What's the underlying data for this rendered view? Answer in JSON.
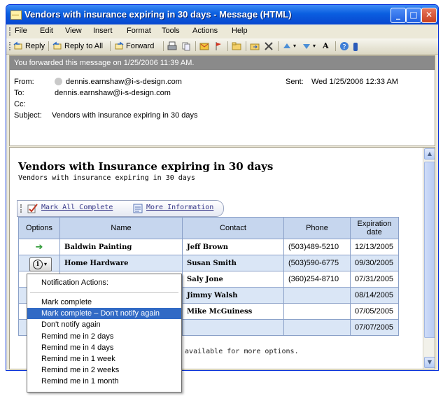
{
  "window": {
    "title": "Vendors with insurance expiring in 30 days - Message (HTML)",
    "min": "_",
    "max": "□",
    "close": "✕"
  },
  "menu": [
    "File",
    "Edit",
    "View",
    "Insert",
    "Format",
    "Tools",
    "Actions",
    "Help"
  ],
  "toolbar": {
    "reply": "Reply",
    "reply_all": "Reply to All",
    "forward": "Forward",
    "format": "A"
  },
  "header": {
    "info": "You forwarded this message on 1/25/2006 11:39 AM.",
    "from_label": "From:",
    "from_value": "dennis.earnshaw@i-s-design.com",
    "to_label": "To:",
    "to_value": "dennis.earnshaw@i-s-design.com",
    "cc_label": "Cc:",
    "subject_label": "Subject:",
    "subject_value": "Vendors with insurance expiring in 30 days",
    "sent_label": "Sent:",
    "sent_value": "Wed 1/25/2006 12:33 AM"
  },
  "doc": {
    "title": "Vendors with Insurance expiring in 30 days",
    "subtitle": "Vendors with insurance expiring in 30 days",
    "mark_all": "Mark All Complete",
    "more_info": "More Information",
    "footer_note": "n available for more options."
  },
  "table": {
    "headers": [
      "Options",
      "Name",
      "Contact",
      "Phone",
      "Expiration date"
    ],
    "rows": [
      {
        "name": "Baldwin Painting",
        "contact": "Jeff Brown",
        "phone": "(503)489-5210",
        "date": "12/13/2005"
      },
      {
        "name": "Home Hardware",
        "contact": "Susan Smith",
        "phone": "(503)590-6775",
        "date": "09/30/2005"
      },
      {
        "name": "",
        "contact": "Saly Jone",
        "phone": "(360)254-8710",
        "date": "07/31/2005"
      },
      {
        "name": "",
        "contact": "Jimmy Walsh",
        "phone": "",
        "date": "08/14/2005"
      },
      {
        "name": "",
        "contact": "Mike McGuiness",
        "phone": "",
        "date": "07/05/2005"
      },
      {
        "name": "",
        "contact": "",
        "phone": "",
        "date": "07/07/2005"
      }
    ]
  },
  "context_menu": {
    "header": "Notification Actions:",
    "items": [
      "Mark complete",
      "Mark complete – Don't notify again",
      "Don't notify again",
      "Remind me in 2 days",
      "Remind me in 4 days",
      "Remind me in 1 week",
      "Remind me in 2 weeks",
      "Remind me in 1 month"
    ],
    "highlight_color": "#316ac5"
  },
  "options_button": {
    "glyph": "i",
    "arrow": "▾"
  },
  "arrows": {
    "up": "▲",
    "down": "▼"
  },
  "row_arrow": "➔"
}
